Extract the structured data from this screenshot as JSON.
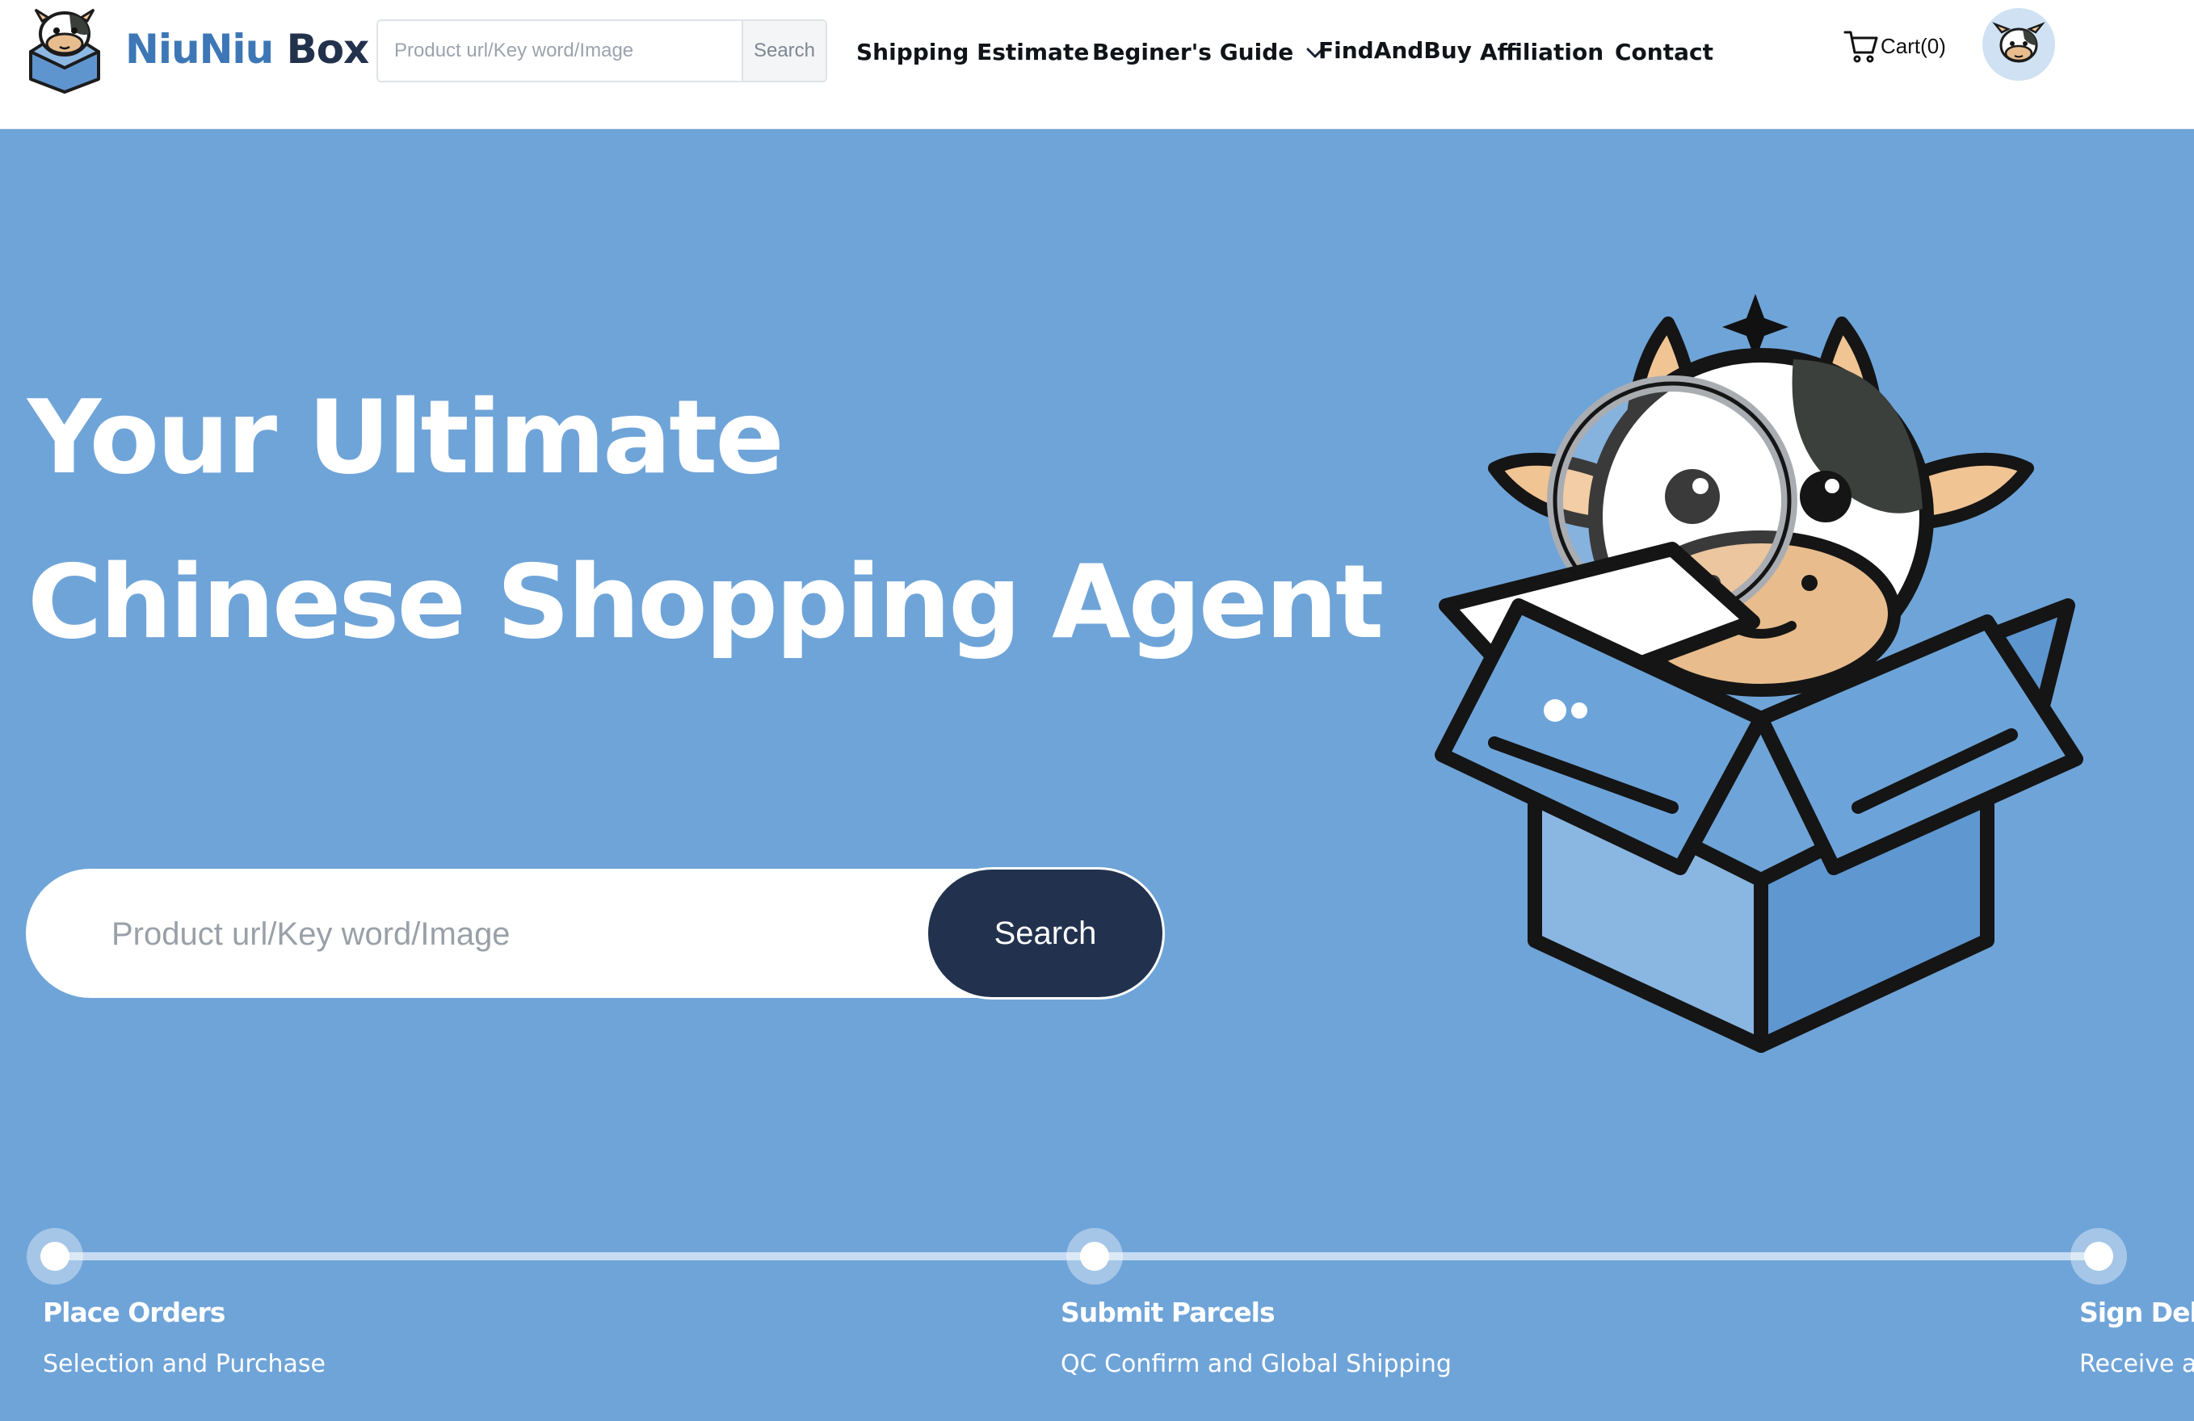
{
  "header": {
    "brand_part1": "NiuNiu",
    "brand_part2": "Box",
    "search": {
      "placeholder": "Product url/Key word/Image",
      "button_label": "Search"
    },
    "nav": {
      "shipping_estimate": "Shipping Estimate",
      "beginners_guide": "Beginer's Guide",
      "find_and_buy": "FindAndBuy",
      "affiliation": "Affiliation",
      "contact": "Contact"
    },
    "cart_label": "Cart(0)"
  },
  "hero": {
    "title_line1": "Your Ultimate",
    "title_line2": "Chinese Shopping Agent",
    "search": {
      "placeholder": "Product url/Key word/Image",
      "button_label": "Search"
    }
  },
  "steps": [
    {
      "title": "Place Orders",
      "subtitle": "Selection and Purchase"
    },
    {
      "title": "Submit Parcels",
      "subtitle": "QC Confirm and Global Shipping"
    },
    {
      "title": "Sign Deliv",
      "subtitle": "Receive ar"
    }
  ],
  "colors": {
    "hero_background": "#6fa4d8",
    "brand_blue": "#3d77b6",
    "navy": "#22324e",
    "white": "#ffffff"
  },
  "icons": {
    "logo": "cow-in-box-logo",
    "nav_guide": "chevron-down-icon",
    "cart": "cart-icon",
    "avatar": "cow-avatar",
    "hero_illustration": "cow-with-magnifier-in-box"
  }
}
